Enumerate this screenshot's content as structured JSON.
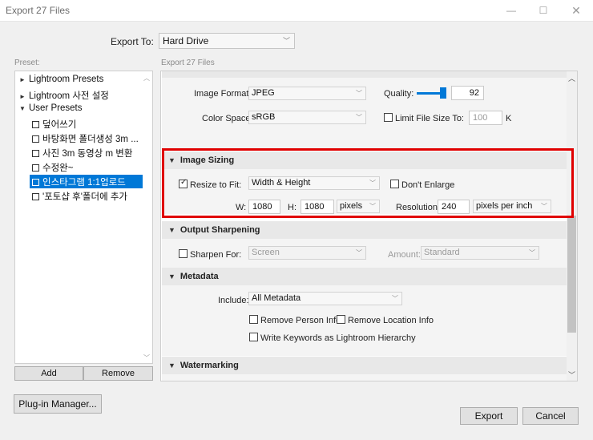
{
  "window": {
    "title": "Export 27 Files"
  },
  "export_to": {
    "label": "Export To:",
    "value": "Hard Drive"
  },
  "preset": {
    "label": "Preset:",
    "items": [
      {
        "label": "Lightroom Presets",
        "kind": "folder"
      },
      {
        "label": "Lightroom 사전 설정",
        "kind": "folder"
      },
      {
        "label": "User Presets",
        "kind": "folder-open"
      },
      {
        "label": "덮어쓰기",
        "kind": "preset"
      },
      {
        "label": "바탕화면 폴더생성 3m ...",
        "kind": "preset"
      },
      {
        "label": "사진 3m 동영상 m 변환",
        "kind": "preset"
      },
      {
        "label": "수정완~",
        "kind": "preset"
      },
      {
        "label": "인스타그램 1:1업로드",
        "kind": "preset",
        "selected": true
      },
      {
        "label": "'포토샵 후'폴더에 추가",
        "kind": "preset"
      }
    ],
    "add": "Add",
    "remove": "Remove"
  },
  "plugin_manager": "Plug-in Manager...",
  "settings_header": "Export 27 Files",
  "file_settings": {
    "image_format_label": "Image Format:",
    "image_format": "JPEG",
    "quality_label": "Quality:",
    "quality": "92",
    "quality_fraction": 0.92,
    "color_space_label": "Color Space:",
    "color_space": "sRGB",
    "limit_label": "Limit File Size To:",
    "limit_value": "100",
    "limit_unit": "K"
  },
  "image_sizing": {
    "title": "Image Sizing",
    "resize_label": "Resize to Fit:",
    "resize_mode": "Width & Height",
    "dont_enlarge": "Don't Enlarge",
    "w_label": "W:",
    "w": "1080",
    "h_label": "H:",
    "h": "1080",
    "unit": "pixels",
    "resolution_label": "Resolution:",
    "resolution": "240",
    "resolution_unit": "pixels per inch"
  },
  "output_sharpening": {
    "title": "Output Sharpening",
    "sharpen_label": "Sharpen For:",
    "sharpen_for": "Screen",
    "amount_label": "Amount:",
    "amount": "Standard"
  },
  "metadata": {
    "title": "Metadata",
    "include_label": "Include:",
    "include": "All Metadata",
    "remove_person": "Remove Person Info",
    "remove_location": "Remove Location Info",
    "write_keywords": "Write Keywords as Lightroom Hierarchy"
  },
  "watermarking": {
    "title": "Watermarking"
  },
  "buttons": {
    "export": "Export",
    "cancel": "Cancel"
  },
  "colors": {
    "accent": "#0078d7",
    "highlight": "#e00000"
  }
}
